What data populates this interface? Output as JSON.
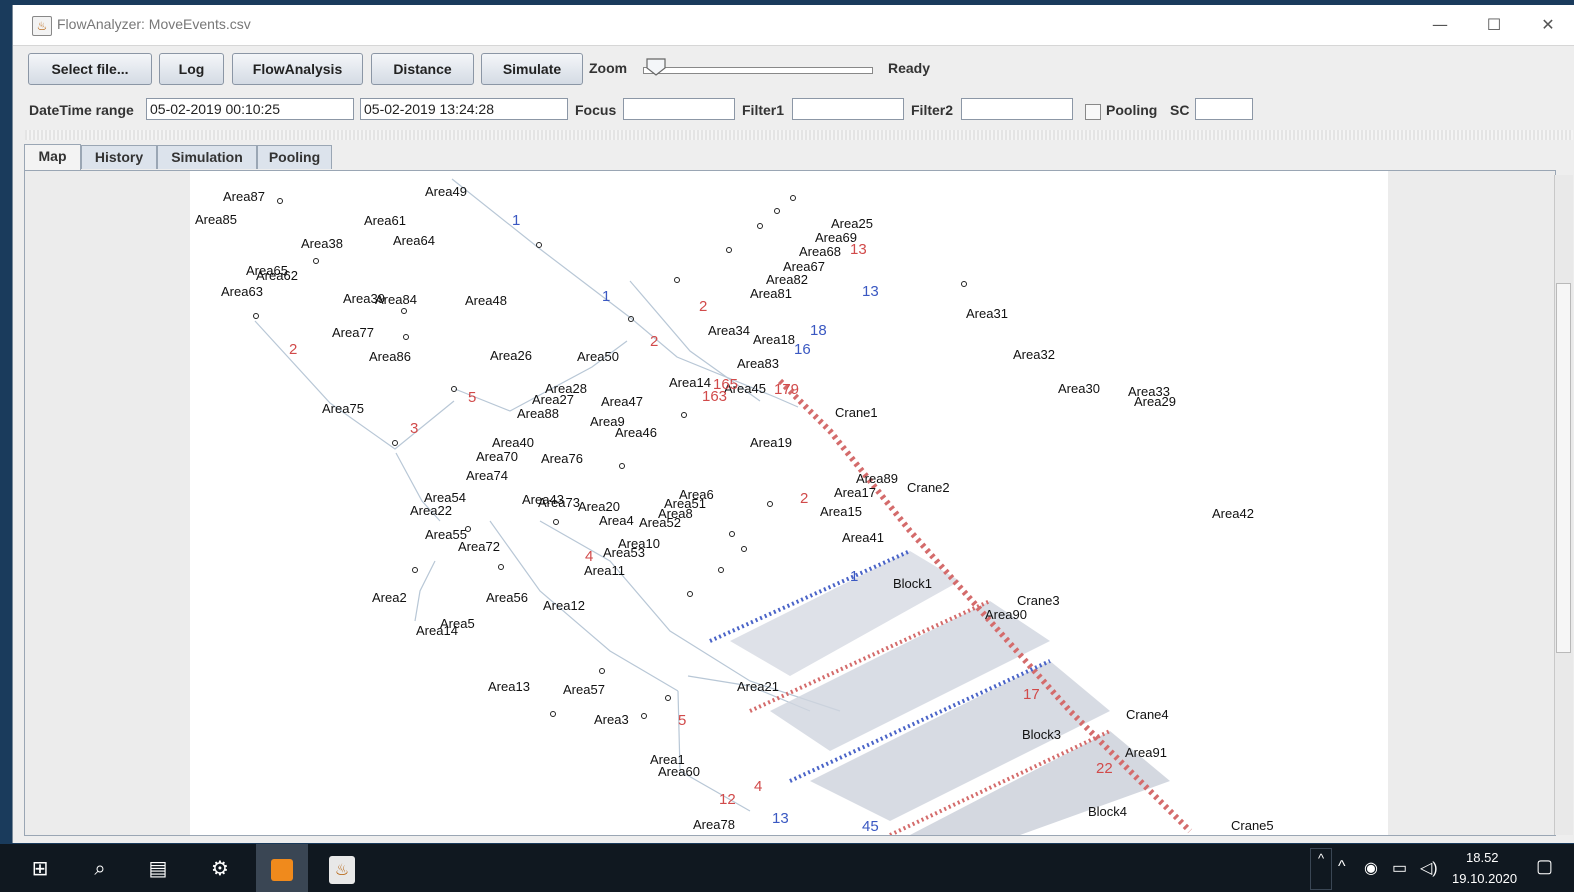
{
  "window": {
    "title": "FlowAnalyzer: MoveEvents.csv",
    "controls": {
      "minimize": "—",
      "maximize": "☐",
      "close": "✕"
    }
  },
  "toolbar": {
    "select_file": "Select file...",
    "log": "Log",
    "flow_analysis": "FlowAnalysis",
    "distance": "Distance",
    "simulate": "Simulate",
    "zoom_label": "Zoom",
    "status": "Ready"
  },
  "filters": {
    "datetime_label": "DateTime range",
    "start": "05-02-2019 00:10:25",
    "end": "05-02-2019 13:24:28",
    "focus_label": "Focus",
    "focus_value": "",
    "filter1_label": "Filter1",
    "filter1_value": "",
    "filter2_label": "Filter2",
    "filter2_value": "",
    "pooling_label": "Pooling",
    "pooling_checked": false,
    "sc_label": "SC",
    "sc_value": ""
  },
  "tabs": [
    {
      "label": "Map",
      "active": true
    },
    {
      "label": "History",
      "active": false
    },
    {
      "label": "Simulation",
      "active": false
    },
    {
      "label": "Pooling",
      "active": false
    }
  ],
  "map": {
    "labels": [
      "Area87",
      "Area85",
      "Area49",
      "Area61",
      "Area64",
      "Area38",
      "Area65",
      "Area62",
      "Area63",
      "Area39",
      "Area84",
      "Area48",
      "Area77",
      "Area86",
      "Area26",
      "Area50",
      "Area75",
      "Area28",
      "Area27",
      "Area47",
      "Area88",
      "Area9",
      "Area46",
      "Area40",
      "Area70",
      "Area76",
      "Area74",
      "Area54",
      "Area22",
      "Area43",
      "Area73",
      "Area20",
      "Area6",
      "Area51",
      "Area8",
      "Area4",
      "Area52",
      "Area55",
      "Area72",
      "Area10",
      "Area53",
      "Area11",
      "Area2",
      "Area56",
      "Area12",
      "Area14",
      "Area5",
      "Area13",
      "Area57",
      "Area3",
      "Area1",
      "Area60",
      "Area78",
      "Area25",
      "Area69",
      "Area68",
      "Area67",
      "Area82",
      "Area81",
      "Area34",
      "Area18",
      "Area83",
      "Area14",
      "Area45",
      "Area19",
      "Area17",
      "Area15",
      "Area41",
      "Area89",
      "Area31",
      "Area32",
      "Area30",
      "Area33",
      "Area29",
      "Area42",
      "Area90",
      "Area91",
      "Area21",
      "Crane1",
      "Crane2",
      "Crane3",
      "Crane4",
      "Crane5",
      "Block1",
      "Block3",
      "Block4"
    ],
    "flow_numbers": [
      "1",
      "2",
      "3",
      "5",
      "13",
      "16",
      "18",
      "179",
      "165",
      "163",
      "12",
      "17",
      "22",
      "45",
      "4"
    ]
  },
  "taskbar": {
    "time": "18.52",
    "date": "19.10.2020"
  }
}
